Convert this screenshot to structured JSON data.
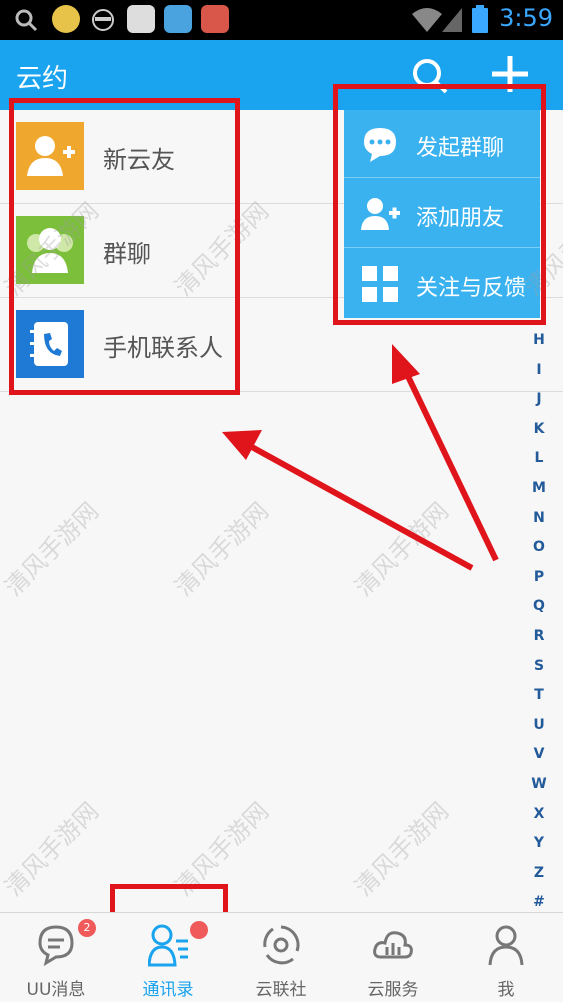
{
  "status_bar": {
    "time": "3:59"
  },
  "app_bar": {
    "title": "云约"
  },
  "list": [
    {
      "label": "新云友",
      "icon": "add-user-icon",
      "color": "#f0a72e"
    },
    {
      "label": "群聊",
      "icon": "group-icon",
      "color": "#7bbf3b"
    },
    {
      "label": "手机联系人",
      "icon": "phonebook-icon",
      "color": "#1f7ad6"
    }
  ],
  "menu": [
    {
      "label": "发起群聊",
      "icon": "chat-bubble-icon"
    },
    {
      "label": "添加朋友",
      "icon": "add-user-icon"
    },
    {
      "label": "关注与反馈",
      "icon": "qr-code-icon"
    }
  ],
  "index_letters": [
    "H",
    "I",
    "J",
    "K",
    "L",
    "M",
    "N",
    "O",
    "P",
    "Q",
    "R",
    "S",
    "T",
    "U",
    "V",
    "W",
    "X",
    "Y",
    "Z",
    "#"
  ],
  "tabs": [
    {
      "label": "UU消息",
      "badge": "2"
    },
    {
      "label": "通讯录"
    },
    {
      "label": "云联社"
    },
    {
      "label": "云服务"
    },
    {
      "label": "我"
    }
  ],
  "watermark": "清风手游网",
  "colors": {
    "primary": "#1aa3ee",
    "menu": "#3ab2f0",
    "annotation": "#e0151b"
  }
}
